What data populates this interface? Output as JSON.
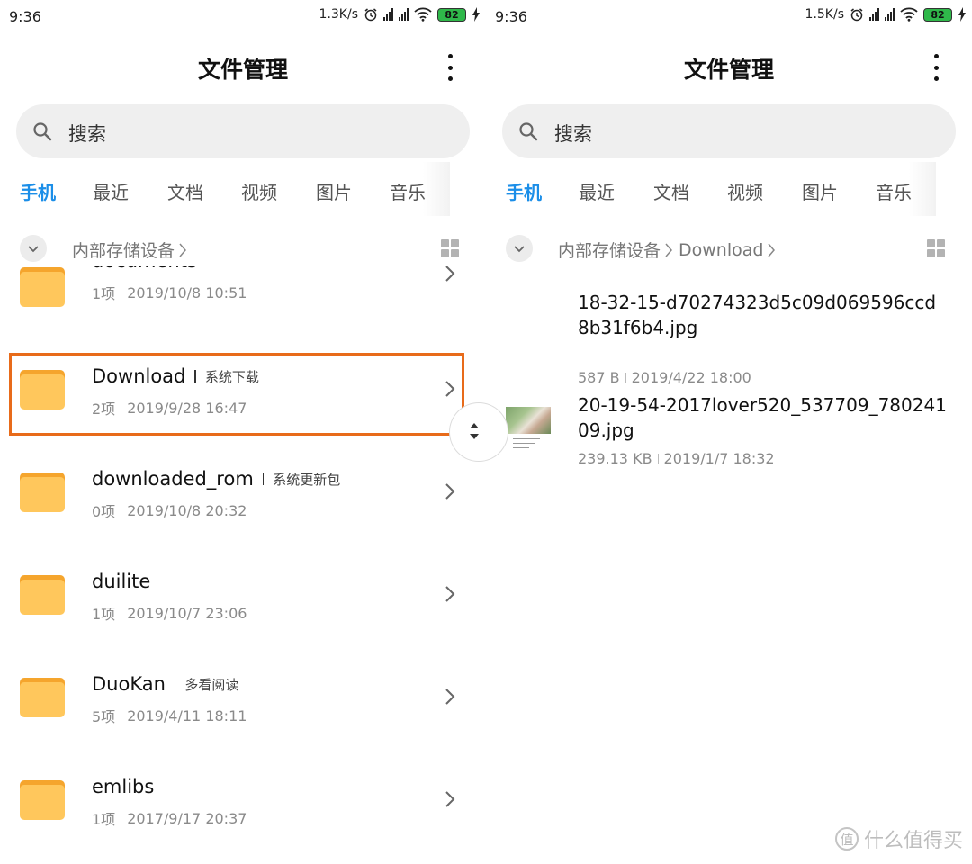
{
  "left": {
    "status": {
      "time": "9:36",
      "speed": "1.3K/s",
      "battery": "82"
    },
    "title": "文件管理",
    "search_placeholder": "搜索",
    "tabs": [
      "手机",
      "最近",
      "文档",
      "视频",
      "图片",
      "音乐"
    ],
    "breadcrumb": [
      "内部存储设备"
    ],
    "folders": [
      {
        "name": "documents",
        "tag": "",
        "count": "1项",
        "date": "2019/10/8 10:51"
      },
      {
        "name": "Download",
        "tag": "系统下载",
        "count": "2项",
        "date": "2019/9/28 16:47"
      },
      {
        "name": "downloaded_rom",
        "tag": "系统更新包",
        "count": "0项",
        "date": "2019/10/8 20:32"
      },
      {
        "name": "duilite",
        "tag": "",
        "count": "1项",
        "date": "2019/10/7 23:06"
      },
      {
        "name": "DuoKan",
        "tag": "多看阅读",
        "count": "5项",
        "date": "2019/4/11 18:11"
      },
      {
        "name": "emlibs",
        "tag": "",
        "count": "1项",
        "date": "2017/9/17 20:37"
      }
    ]
  },
  "right": {
    "status": {
      "time": "9:36",
      "speed": "1.5K/s",
      "battery": "82"
    },
    "title": "文件管理",
    "search_placeholder": "搜索",
    "tabs": [
      "手机",
      "最近",
      "文档",
      "视频",
      "图片",
      "音乐"
    ],
    "breadcrumb": [
      "内部存储设备",
      "Download"
    ],
    "files": [
      {
        "name": "18-32-15-d70274323d5c09d069596ccd8b31f6b4.jpg",
        "size": "587 B",
        "date": "2019/4/22 18:00"
      },
      {
        "name": "20-19-54-2017lover520_537709_78024109.jpg",
        "size": "239.13 KB",
        "date": "2019/1/7 18:32"
      }
    ]
  },
  "watermark": "什么值得买",
  "colors": {
    "accent": "#1b8ee8",
    "highlight": "#e86b1a",
    "folder": "#ffc75c",
    "battery": "#2fb84a"
  }
}
